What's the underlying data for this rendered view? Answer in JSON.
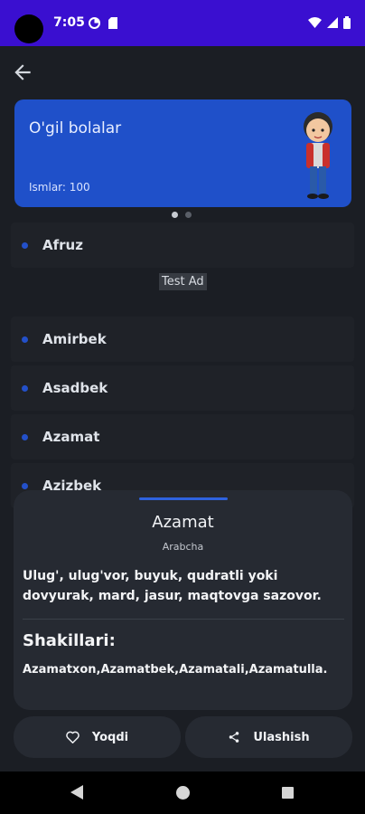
{
  "status_bar": {
    "time": "7:05"
  },
  "banner": {
    "title": "O'gil bolalar",
    "count": "Ismlar: 100"
  },
  "names": [
    "Afruz",
    "Amirbek",
    "Asadbek",
    "Azamat",
    "Azizbek"
  ],
  "ad": {
    "label": "Test Ad"
  },
  "detail": {
    "name": "Azamat",
    "origin": "Arabcha",
    "meaning": "Ulug', ulug'vor, buyuk, qudratli yoki dovyurak, mard, jasur, maqtovga sazovor.",
    "forms_title": "Shakillari:",
    "forms": "Azamatxon,Azamatbek,Azamatali,Azamatulla."
  },
  "actions": {
    "like": "Yoqdi",
    "share": "Ulashish"
  },
  "colors": {
    "accent": "#1f50c9",
    "status_bar": "#3a0fd0",
    "background": "#1b1e24"
  }
}
